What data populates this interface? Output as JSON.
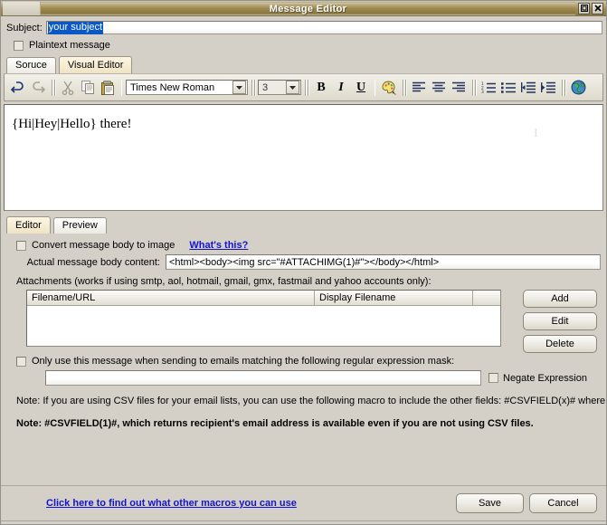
{
  "window": {
    "title": "Message Editor",
    "maximize_icon": "maximize-icon",
    "close_icon": "close-icon"
  },
  "subject": {
    "label": "Subject:",
    "value": "your subject",
    "placeholder": ""
  },
  "plaintext": {
    "label": "Plaintext message",
    "checked": false
  },
  "editor_tabs": [
    {
      "label": "Soruce",
      "active": false
    },
    {
      "label": "Visual Editor",
      "active": true
    }
  ],
  "toolbar": {
    "undo_icon": "undo-icon",
    "redo_icon": "redo-icon",
    "cut_icon": "cut-icon",
    "copy_icon": "copy-icon",
    "paste_icon": "paste-icon",
    "font_name": "Times New Roman",
    "font_size": "3",
    "bold_label": "B",
    "italic_label": "I",
    "underline_label": "U",
    "color_icon": "color-palette-icon",
    "align_left_icon": "align-left-icon",
    "align_center_icon": "align-center-icon",
    "align_right_icon": "align-right-icon",
    "ordered_list_icon": "numbered-list-icon",
    "bullet_list_icon": "bullet-list-icon",
    "outdent_icon": "outdent-icon",
    "indent_icon": "indent-icon",
    "link_icon": "globe-link-icon"
  },
  "message_body": {
    "text": "{Hi|Hey|Hello} there!"
  },
  "view_tabs": [
    {
      "label": "Editor",
      "active": true
    },
    {
      "label": "Preview",
      "active": false
    }
  ],
  "convert": {
    "label": "Convert message body to image",
    "help_link": "What's this?",
    "checked": false
  },
  "body_content": {
    "label": "Actual message body content:",
    "value": "<html><body><img src=\"#ATTACHIMG(1)#\"></body></html>"
  },
  "attachments": {
    "label": "Attachments (works if using smtp, aol, hotmail, gmail, gmx, fastmail and yahoo accounts only):",
    "columns": [
      "Filename/URL",
      "Display Filename",
      ""
    ],
    "rows": [],
    "buttons": {
      "add": "Add",
      "edit": "Edit",
      "delete": "Delete"
    }
  },
  "regex": {
    "label": "Only use this message when sending to emails matching the following regular expression mask:",
    "checked": false,
    "value": "",
    "negate_label": "Negate Expression",
    "negate_checked": false
  },
  "notes": {
    "note1": "Note: If you are using CSV files for your email lists, you can use the following macro to include the other fields: #CSVFIELD(x)# where x is the number of the column(field). For example #CSVFIELD(1)# would return the recipient's email address.",
    "note2": "Note: #CSVFIELD(1)#, which returns recipient's email address is available even if you are not using CSV files."
  },
  "footer": {
    "macro_link": "Click here to find out what other macros you can use",
    "save": "Save",
    "cancel": "Cancel"
  },
  "colors": {
    "window_bg": "#d4d0c8",
    "title_gold": "#9d8a51",
    "selection_blue": "#0a57c8",
    "link_blue": "#1414cf",
    "tab_active": "#efe3c4"
  }
}
